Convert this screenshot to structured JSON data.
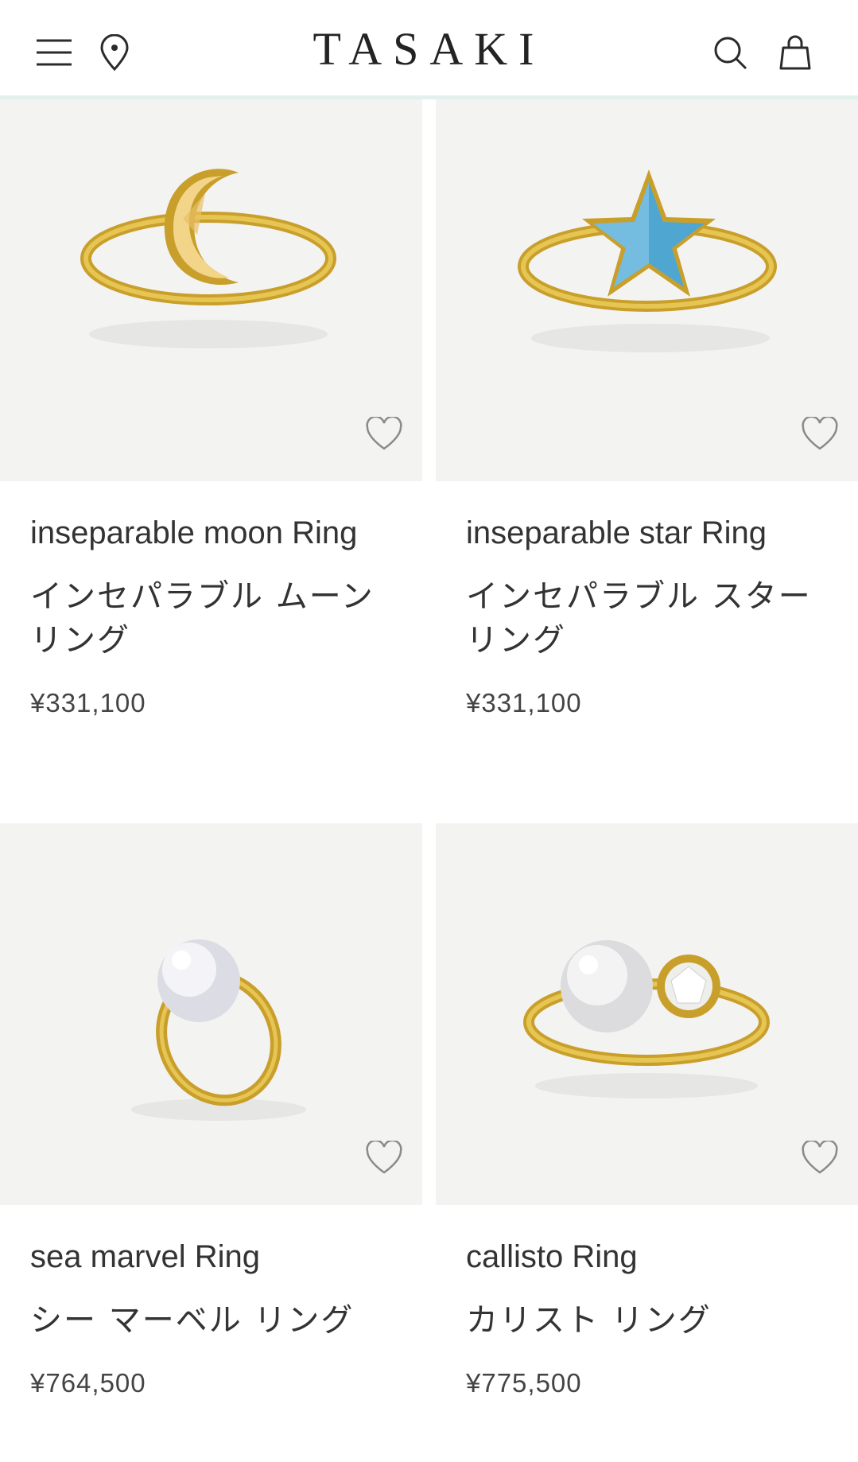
{
  "header": {
    "brand": "TASAKI",
    "icons": [
      "menu-icon",
      "location-pin-icon",
      "search-icon",
      "shopping-bag-icon"
    ]
  },
  "products": [
    {
      "name_en": "inseparable moon Ring",
      "name_ja": "インセパラブル ムーン リング",
      "price": "¥331,100"
    },
    {
      "name_en": "inseparable star Ring",
      "name_ja": "インセパラブル スター リング",
      "price": "¥331,100"
    },
    {
      "name_en": "sea marvel Ring",
      "name_ja": "シー マーベル リング",
      "price": "¥764,500"
    },
    {
      "name_en": "callisto Ring",
      "name_ja": "カリスト リング",
      "price": "¥775,500"
    }
  ],
  "colors": {
    "accent_line": "#e2f1ee",
    "image_bg": "#f3f3f2",
    "gold": "#d3ad34",
    "text": "#333333"
  }
}
